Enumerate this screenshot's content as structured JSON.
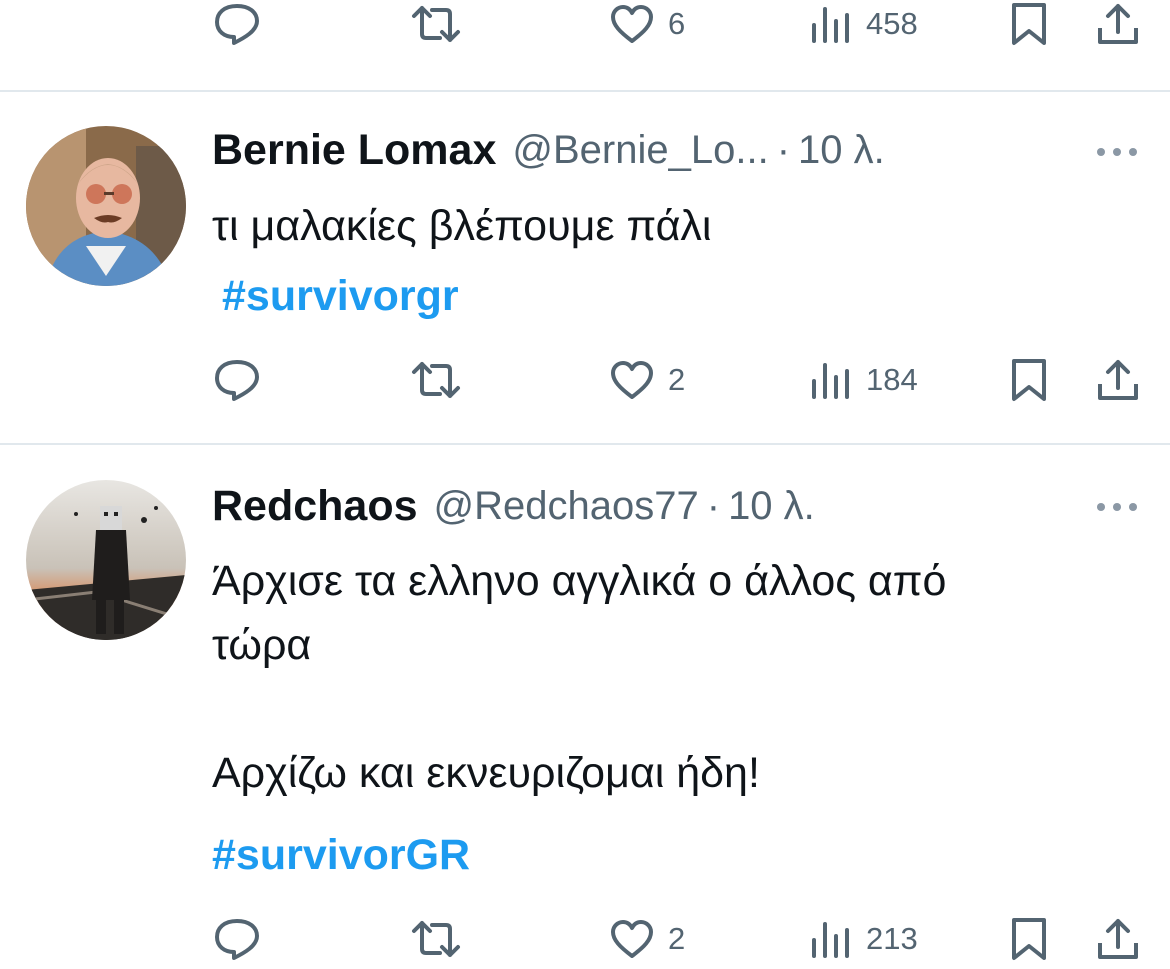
{
  "top_actions": {
    "likes": "6",
    "views": "458"
  },
  "tweets": [
    {
      "name": "Bernie Lomax",
      "handle": "@Bernie_Lo...",
      "separator": "·",
      "time": "10 λ.",
      "text": "τι μαλακίες βλέπουμε πάλι",
      "hashtag": "#survivorgr",
      "likes": "2",
      "views": "184"
    },
    {
      "name": "Redchaos",
      "handle": "@Redchaos77",
      "separator": "·",
      "time": "10 λ.",
      "text": "Άρχισε τα ελληνο αγγλικά ο άλλος από\nτώρα\n\nΑρχίζω και εκνευριζομαι ήδη!",
      "hashtag": "#survivorGR",
      "likes": "2",
      "views": "213"
    }
  ],
  "icons": [
    "reply-icon",
    "retweet-icon",
    "like-icon",
    "views-icon",
    "bookmark-icon",
    "share-icon",
    "more-icon"
  ],
  "colors": {
    "text": "#0f1419",
    "secondary": "#536471",
    "link": "#1d9bf0",
    "divider": "#e1e8ed"
  }
}
